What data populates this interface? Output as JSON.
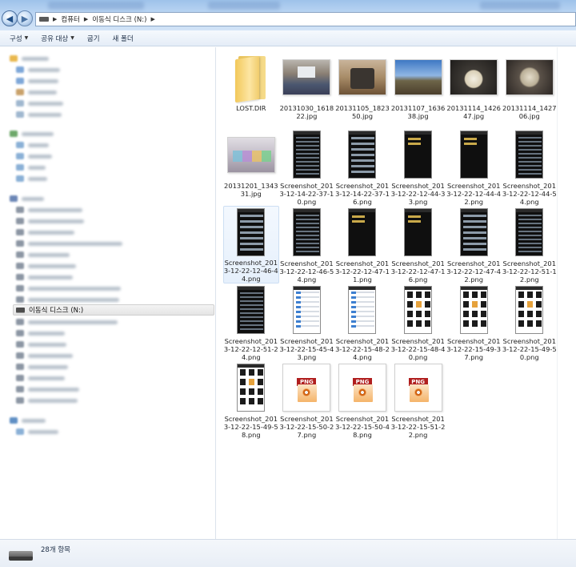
{
  "address_bar": {
    "segments": [
      "컴퓨터",
      "이동식 디스크 (N:)"
    ]
  },
  "toolbar": {
    "organize": "구성",
    "share": "공유 대상",
    "burn": "굽기",
    "new_folder": "새 폴더"
  },
  "nav_pane": {
    "selected_drive": "이동식 디스크 (N:)"
  },
  "files": [
    {
      "name": "LOST.DIR",
      "kind": "folder"
    },
    {
      "name": "20131030_161822.jpg",
      "kind": "photo"
    },
    {
      "name": "20131105_182350.jpg",
      "kind": "photo"
    },
    {
      "name": "20131107_163638.jpg",
      "kind": "photo"
    },
    {
      "name": "20131114_142647.jpg",
      "kind": "photo"
    },
    {
      "name": "20131114_142706.jpg",
      "kind": "photo"
    },
    {
      "name": "20131201_134331.jpg",
      "kind": "photo"
    },
    {
      "name": "Screenshot_2013-12-14-22-37-10.png",
      "kind": "screenshot"
    },
    {
      "name": "Screenshot_2013-12-14-22-37-16.png",
      "kind": "screenshot"
    },
    {
      "name": "Screenshot_2013-12-22-12-44-33.png",
      "kind": "screenshot"
    },
    {
      "name": "Screenshot_2013-12-22-12-44-42.png",
      "kind": "screenshot"
    },
    {
      "name": "Screenshot_2013-12-22-12-44-54.png",
      "kind": "screenshot"
    },
    {
      "name": "Screenshot_2013-12-22-12-46-44.png",
      "kind": "screenshot",
      "selected": true
    },
    {
      "name": "Screenshot_2013-12-22-12-46-54.png",
      "kind": "screenshot"
    },
    {
      "name": "Screenshot_2013-12-22-12-47-11.png",
      "kind": "screenshot"
    },
    {
      "name": "Screenshot_2013-12-22-12-47-16.png",
      "kind": "screenshot"
    },
    {
      "name": "Screenshot_2013-12-22-12-47-42.png",
      "kind": "screenshot"
    },
    {
      "name": "Screenshot_2013-12-22-12-51-12.png",
      "kind": "screenshot"
    },
    {
      "name": "Screenshot_2013-12-22-12-51-24.png",
      "kind": "screenshot"
    },
    {
      "name": "Screenshot_2013-12-22-15-45-43.png",
      "kind": "screenshot"
    },
    {
      "name": "Screenshot_2013-12-22-15-48-24.png",
      "kind": "screenshot"
    },
    {
      "name": "Screenshot_2013-12-22-15-48-40.png",
      "kind": "screenshot"
    },
    {
      "name": "Screenshot_2013-12-22-15-49-37.png",
      "kind": "screenshot"
    },
    {
      "name": "Screenshot_2013-12-22-15-49-50.png",
      "kind": "screenshot"
    },
    {
      "name": "Screenshot_2013-12-22-15-49-58.png",
      "kind": "screenshot"
    },
    {
      "name": "Screenshot_2013-12-22-15-50-27.png",
      "kind": "png"
    },
    {
      "name": "Screenshot_2013-12-22-15-50-48.png",
      "kind": "png"
    },
    {
      "name": "Screenshot_2013-12-22-15-51-22.png",
      "kind": "png"
    }
  ],
  "png_label": "PNG",
  "status": {
    "count": "28개 항목"
  }
}
